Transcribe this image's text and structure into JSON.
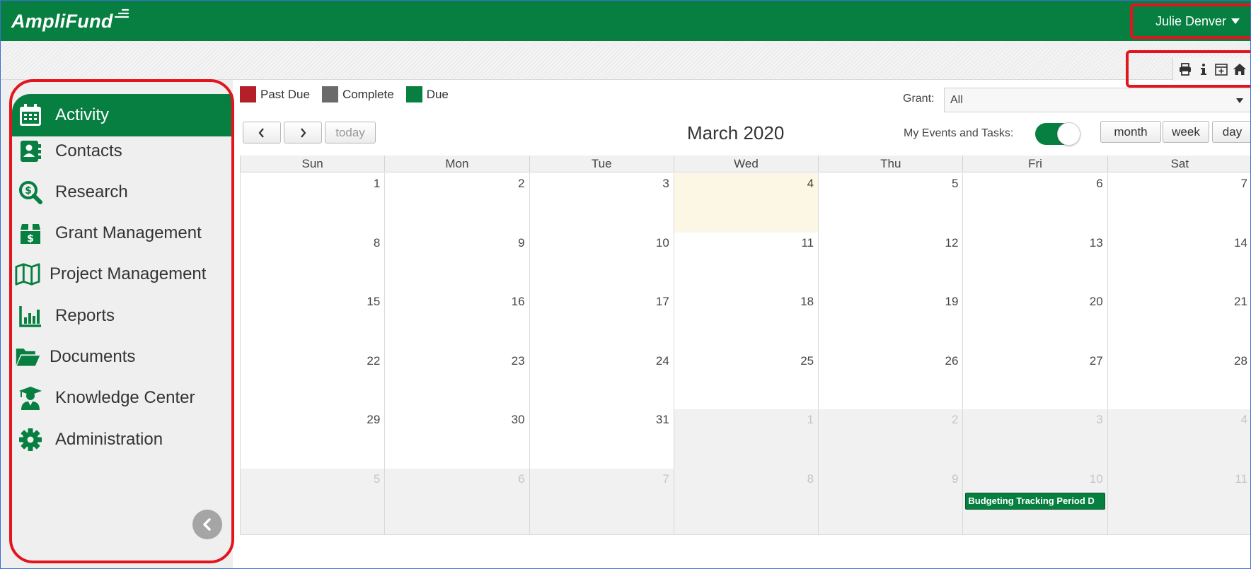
{
  "app": {
    "logo_text": "AmpliFund",
    "brand_color": "#067f40",
    "user_name": "Julie Denver"
  },
  "toolbar_icons": [
    "print-icon",
    "info-icon",
    "calendar-add-icon",
    "home-icon"
  ],
  "sidebar": {
    "items": [
      {
        "label": "Activity",
        "icon": "calendar-icon",
        "active": true
      },
      {
        "label": "Contacts",
        "icon": "contact-card-icon"
      },
      {
        "label": "Research",
        "icon": "dollar-search-icon"
      },
      {
        "label": "Grant Management",
        "icon": "money-box-icon"
      },
      {
        "label": "Project Management",
        "icon": "map-icon"
      },
      {
        "label": "Reports",
        "icon": "bar-chart-icon"
      },
      {
        "label": "Documents",
        "icon": "folder-open-icon"
      },
      {
        "label": "Knowledge Center",
        "icon": "graduate-icon"
      },
      {
        "label": "Administration",
        "icon": "gear-icon"
      }
    ]
  },
  "legend": [
    {
      "label": "Past Due",
      "color": "#b3202a"
    },
    {
      "label": "Complete",
      "color": "#6a6a6a"
    },
    {
      "label": "Due",
      "color": "#067f40"
    }
  ],
  "filters": {
    "grant_label": "Grant:",
    "grant_value": "All",
    "toggle_label": "My Events and Tasks:",
    "toggle_on": true
  },
  "calendar": {
    "title": "March 2020",
    "today_label": "today",
    "views": {
      "month": "month",
      "week": "week",
      "day": "day"
    },
    "weekdays": [
      "Sun",
      "Mon",
      "Tue",
      "Wed",
      "Thu",
      "Fri",
      "Sat"
    ],
    "weeks": [
      [
        {
          "n": "1"
        },
        {
          "n": "2"
        },
        {
          "n": "3"
        },
        {
          "n": "4",
          "today": true
        },
        {
          "n": "5"
        },
        {
          "n": "6"
        },
        {
          "n": "7"
        }
      ],
      [
        {
          "n": "8"
        },
        {
          "n": "9"
        },
        {
          "n": "10"
        },
        {
          "n": "11"
        },
        {
          "n": "12"
        },
        {
          "n": "13"
        },
        {
          "n": "14"
        }
      ],
      [
        {
          "n": "15"
        },
        {
          "n": "16"
        },
        {
          "n": "17"
        },
        {
          "n": "18"
        },
        {
          "n": "19"
        },
        {
          "n": "20"
        },
        {
          "n": "21"
        }
      ],
      [
        {
          "n": "22"
        },
        {
          "n": "23"
        },
        {
          "n": "24"
        },
        {
          "n": "25"
        },
        {
          "n": "26"
        },
        {
          "n": "27"
        },
        {
          "n": "28"
        }
      ],
      [
        {
          "n": "29"
        },
        {
          "n": "30"
        },
        {
          "n": "31"
        },
        {
          "n": "1",
          "other": true
        },
        {
          "n": "2",
          "other": true
        },
        {
          "n": "3",
          "other": true
        },
        {
          "n": "4",
          "other": true
        }
      ],
      [
        {
          "n": "5",
          "other": true
        },
        {
          "n": "6",
          "other": true
        },
        {
          "n": "7",
          "other": true
        },
        {
          "n": "8",
          "other": true
        },
        {
          "n": "9",
          "other": true
        },
        {
          "n": "10",
          "other": true,
          "event": "Budgeting Tracking Period D"
        },
        {
          "n": "11",
          "other": true
        }
      ]
    ]
  }
}
